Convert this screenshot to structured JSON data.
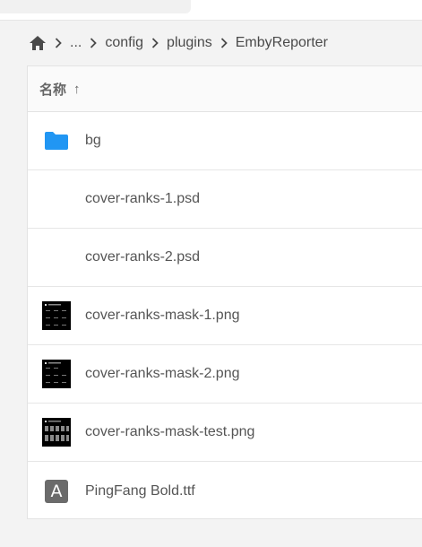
{
  "breadcrumb": {
    "home_icon": "home-icon",
    "items": [
      "...",
      "config",
      "plugins",
      "EmbyReporter"
    ]
  },
  "table": {
    "column_name": "名称",
    "sort_arrow": "↑"
  },
  "files": [
    {
      "name": "bg",
      "type": "folder",
      "icon": "folder-icon"
    },
    {
      "name": "cover-ranks-1.psd",
      "type": "psd",
      "icon": "none"
    },
    {
      "name": "cover-ranks-2.psd",
      "type": "psd",
      "icon": "none"
    },
    {
      "name": "cover-ranks-mask-1.png",
      "type": "image",
      "icon": "image-thumbnail"
    },
    {
      "name": "cover-ranks-mask-2.png",
      "type": "image",
      "icon": "image-thumbnail"
    },
    {
      "name": "cover-ranks-mask-test.png",
      "type": "image",
      "icon": "image-thumbnail"
    },
    {
      "name": "PingFang Bold.ttf",
      "type": "font",
      "icon": "font-icon",
      "icon_letter": "A"
    }
  ],
  "colors": {
    "folder": "#2196f3",
    "font_icon": "#6b6b6b"
  }
}
